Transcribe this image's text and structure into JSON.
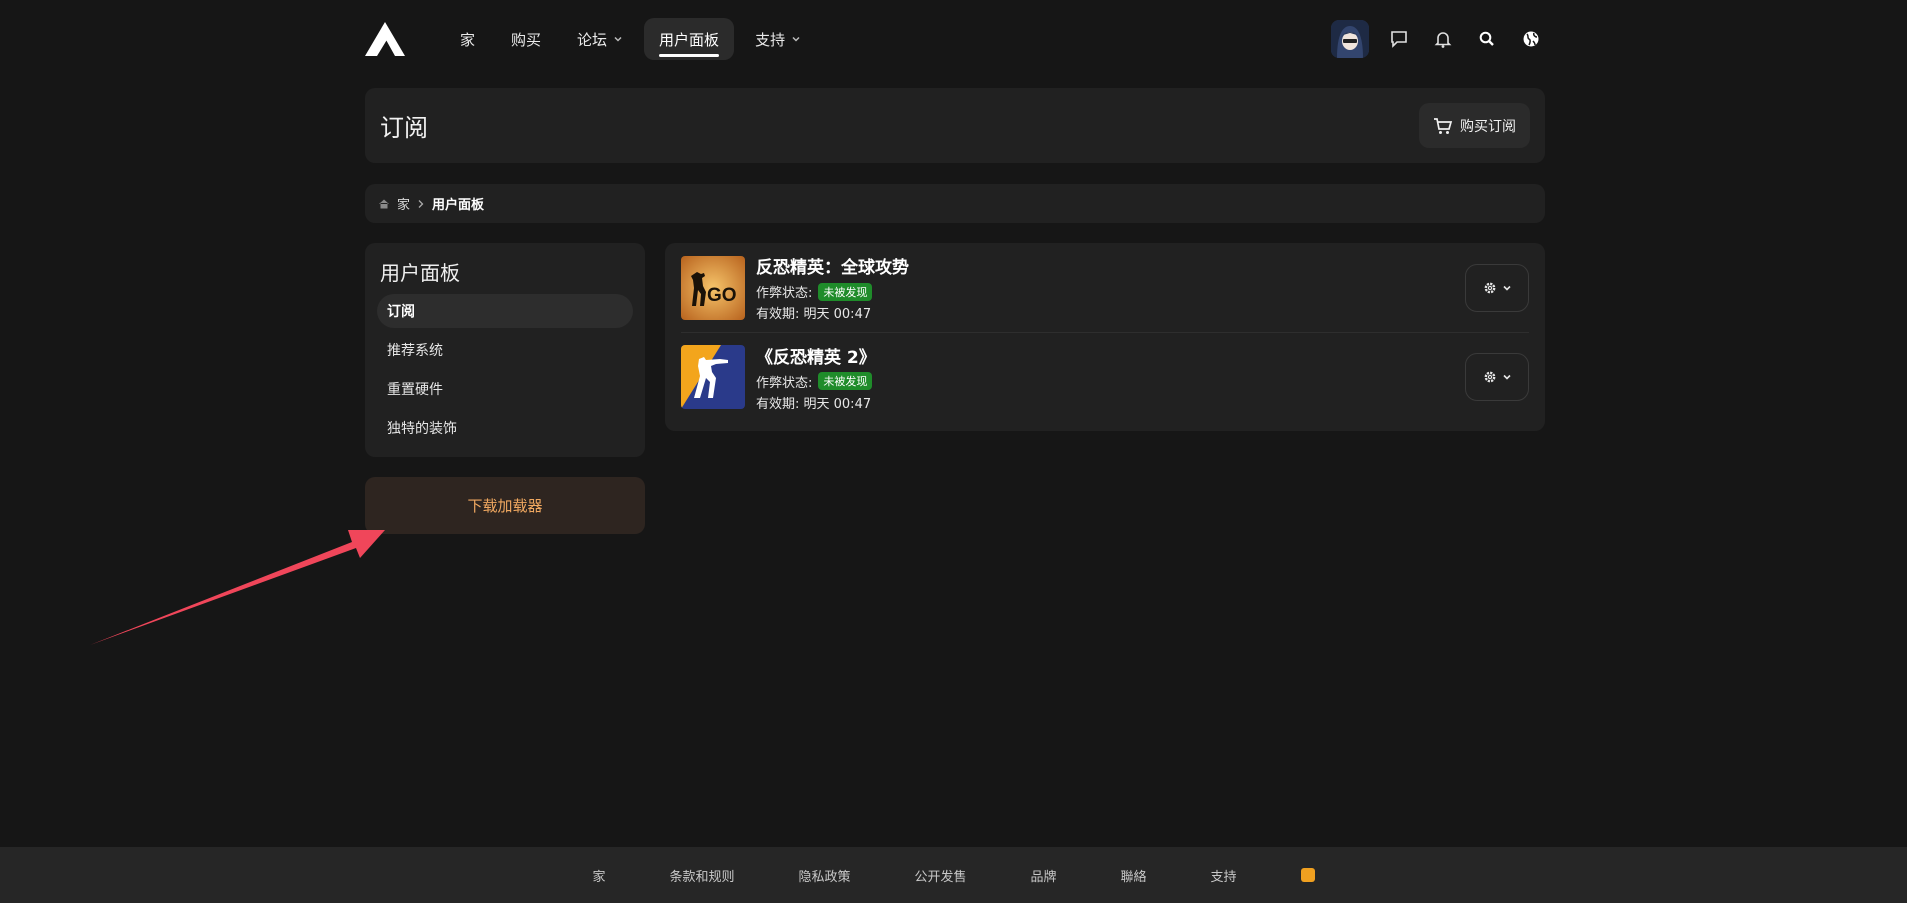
{
  "nav": {
    "items": [
      {
        "label": "家",
        "dropdown": false
      },
      {
        "label": "购买",
        "dropdown": false
      },
      {
        "label": "论坛",
        "dropdown": true
      },
      {
        "label": "用户面板",
        "dropdown": false,
        "active": true
      },
      {
        "label": "支持",
        "dropdown": true
      }
    ],
    "icons": [
      "avatar",
      "chat-icon",
      "bell-icon",
      "search-icon",
      "globe-icon"
    ]
  },
  "page": {
    "title": "订阅",
    "buy_button": "购买订阅"
  },
  "breadcrumb": {
    "home": "家",
    "current": "用户面板"
  },
  "sidebar": {
    "title": "用户面板",
    "items": [
      {
        "label": "订阅",
        "active": true
      },
      {
        "label": "推荐系统"
      },
      {
        "label": "重置硬件"
      },
      {
        "label": "独特的装饰"
      }
    ],
    "download_button": "下载加载器"
  },
  "subscriptions": [
    {
      "title": "反恐精英：全球攻势",
      "status_label": "作弊状态:",
      "status_badge": "未被发现",
      "expiry": "有效期: 明天 00:47",
      "icon": "csgo-icon"
    },
    {
      "title": "《反恐精英 2》",
      "status_label": "作弊状态:",
      "status_badge": "未被发现",
      "expiry": "有效期: 明天 00:47",
      "icon": "cs2-icon"
    }
  ],
  "footer": {
    "links": [
      "家",
      "条款和规则",
      "隐私政策",
      "公开发售",
      "品牌",
      "聯絡",
      "支持"
    ]
  },
  "colors": {
    "background": "#161616",
    "card": "#212121",
    "accent_orange": "#f0a860",
    "badge_green": "#1f8c2a",
    "annotation_arrow": "#f0465a"
  }
}
